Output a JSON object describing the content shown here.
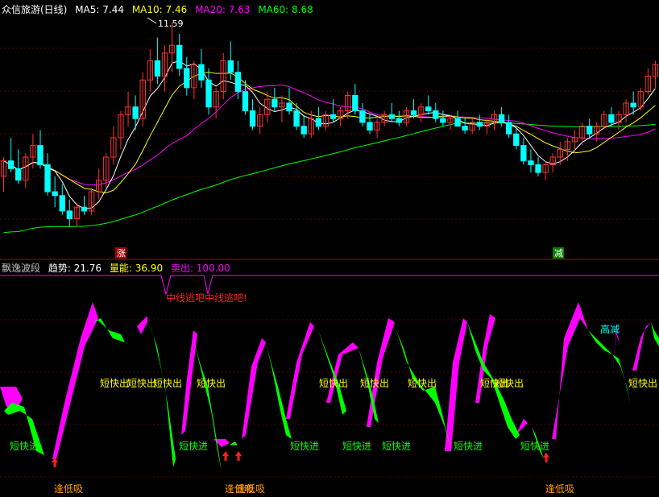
{
  "top_panel": {
    "title": "众信旅游(日线)",
    "ma5_label": "MA5: 7.44",
    "ma10_label": "MA10: 7.46",
    "ma20_label": "MA20: 7.63",
    "ma60_label": "MA60: 8.68",
    "high_marker": "11.59",
    "zhang_label": "涨",
    "jian_label": "减"
  },
  "bottom_panel": {
    "name": "飘逸波段",
    "trend_label": "趋势: 21.76",
    "energy_label": "量能: 36.90",
    "sell_label": "卖出: 100.00",
    "warning_text": "中线逃吧中线逃吧!",
    "gao_jian": "高减",
    "duan_kuai_chu": "短快出",
    "duan_kuai_jin": "短快进",
    "feng_di_xi": "逢低吸"
  },
  "colors": {
    "up": "#ff3232",
    "down": "#00ffff",
    "ma5": "#ffffff",
    "ma10": "#ffff00",
    "ma20": "#ff00ff",
    "ma60": "#00ff00",
    "magenta_band": "#ff00ff",
    "green_band": "#00ff00",
    "label_yellow": "#ffff00",
    "label_green": "#00ff00",
    "label_orange": "#ffa000",
    "warning_red": "#ff2020"
  },
  "chart_data": [
    {
      "type": "candlestick",
      "title": "众信旅游(日线)",
      "high_marker": 11.59,
      "candles": [
        [
          7.6,
          8.1,
          7.2,
          8.0
        ],
        [
          8.0,
          8.6,
          7.7,
          7.8
        ],
        [
          7.8,
          8.3,
          7.4,
          7.5
        ],
        [
          7.5,
          8.2,
          7.3,
          8.1
        ],
        [
          8.1,
          8.7,
          7.8,
          8.4
        ],
        [
          8.4,
          8.8,
          7.8,
          7.9
        ],
        [
          7.9,
          8.2,
          7.1,
          7.2
        ],
        [
          7.2,
          7.6,
          6.8,
          7.1
        ],
        [
          7.1,
          7.4,
          6.6,
          6.7
        ],
        [
          6.7,
          7.0,
          6.3,
          6.5
        ],
        [
          6.5,
          6.9,
          6.3,
          6.8
        ],
        [
          6.8,
          7.1,
          6.6,
          6.7
        ],
        [
          6.7,
          7.3,
          6.6,
          7.2
        ],
        [
          7.2,
          7.8,
          7.0,
          7.5
        ],
        [
          7.5,
          8.2,
          7.3,
          8.1
        ],
        [
          8.1,
          8.9,
          7.9,
          8.6
        ],
        [
          8.6,
          9.3,
          8.3,
          9.2
        ],
        [
          9.2,
          9.8,
          8.9,
          9.4
        ],
        [
          9.4,
          9.7,
          8.8,
          9.1
        ],
        [
          9.1,
          10.3,
          8.9,
          10.1
        ],
        [
          10.1,
          10.9,
          9.8,
          10.6
        ],
        [
          10.6,
          11.2,
          10.0,
          10.2
        ],
        [
          10.2,
          11.0,
          9.8,
          10.8
        ],
        [
          10.8,
          11.59,
          10.3,
          11.0
        ],
        [
          11.0,
          11.3,
          10.2,
          10.4
        ],
        [
          10.4,
          10.7,
          9.7,
          9.9
        ],
        [
          9.9,
          10.6,
          9.6,
          10.5
        ],
        [
          10.5,
          10.9,
          9.9,
          10.1
        ],
        [
          10.1,
          10.4,
          9.2,
          9.4
        ],
        [
          9.4,
          9.9,
          9.1,
          9.8
        ],
        [
          9.8,
          10.8,
          9.6,
          10.6
        ],
        [
          10.6,
          11.1,
          10.1,
          10.3
        ],
        [
          10.3,
          10.6,
          9.6,
          9.8
        ],
        [
          9.8,
          10.1,
          9.2,
          9.3
        ],
        [
          9.3,
          9.6,
          8.8,
          8.9
        ],
        [
          8.9,
          9.4,
          8.7,
          9.2
        ],
        [
          9.2,
          9.8,
          9.0,
          9.6
        ],
        [
          9.6,
          9.9,
          9.3,
          9.4
        ],
        [
          9.4,
          9.7,
          9.0,
          9.5
        ],
        [
          9.5,
          9.9,
          9.2,
          9.3
        ],
        [
          9.3,
          9.5,
          8.8,
          8.9
        ],
        [
          8.9,
          9.2,
          8.6,
          8.7
        ],
        [
          8.7,
          9.3,
          8.6,
          9.1
        ],
        [
          9.1,
          9.4,
          8.8,
          8.9
        ],
        [
          8.9,
          9.3,
          8.8,
          9.2
        ],
        [
          9.2,
          9.6,
          9.0,
          9.1
        ],
        [
          9.1,
          9.4,
          8.9,
          9.3
        ],
        [
          9.3,
          9.8,
          9.1,
          9.7
        ],
        [
          9.7,
          10.0,
          9.2,
          9.3
        ],
        [
          9.3,
          9.5,
          8.9,
          9.0
        ],
        [
          9.0,
          9.2,
          8.7,
          8.8
        ],
        [
          8.8,
          9.1,
          8.6,
          9.0
        ],
        [
          9.0,
          9.3,
          8.9,
          9.2
        ],
        [
          9.2,
          9.5,
          9.0,
          9.1
        ],
        [
          9.1,
          9.3,
          8.9,
          9.0
        ],
        [
          9.0,
          9.4,
          8.9,
          9.3
        ],
        [
          9.3,
          9.6,
          9.1,
          9.2
        ],
        [
          9.2,
          9.5,
          9.0,
          9.4
        ],
        [
          9.4,
          9.7,
          9.2,
          9.3
        ],
        [
          9.3,
          9.5,
          9.0,
          9.1
        ],
        [
          9.1,
          9.3,
          8.9,
          9.0
        ],
        [
          9.0,
          9.2,
          8.8,
          9.1
        ],
        [
          9.1,
          9.3,
          8.9,
          8.9
        ],
        [
          8.9,
          9.1,
          8.7,
          8.8
        ],
        [
          8.8,
          9.1,
          8.7,
          9.0
        ],
        [
          9.0,
          9.2,
          8.8,
          8.9
        ],
        [
          8.9,
          9.1,
          8.7,
          9.0
        ],
        [
          9.0,
          9.3,
          8.8,
          9.2
        ],
        [
          9.2,
          9.4,
          8.9,
          9.0
        ],
        [
          9.0,
          9.2,
          8.6,
          8.7
        ],
        [
          8.7,
          8.9,
          8.3,
          8.4
        ],
        [
          8.4,
          8.6,
          7.9,
          8.0
        ],
        [
          8.0,
          8.3,
          7.7,
          7.9
        ],
        [
          7.9,
          8.1,
          7.6,
          7.7
        ],
        [
          7.7,
          8.0,
          7.5,
          7.9
        ],
        [
          7.9,
          8.2,
          7.7,
          8.1
        ],
        [
          8.1,
          8.5,
          7.9,
          8.3
        ],
        [
          8.3,
          8.6,
          8.0,
          8.5
        ],
        [
          8.5,
          8.8,
          8.2,
          8.6
        ],
        [
          8.6,
          9.0,
          8.4,
          8.9
        ],
        [
          8.9,
          9.1,
          8.6,
          8.7
        ],
        [
          8.7,
          9.0,
          8.5,
          8.9
        ],
        [
          8.9,
          9.3,
          8.8,
          9.2
        ],
        [
          9.2,
          9.4,
          8.9,
          9.0
        ],
        [
          9.0,
          9.3,
          8.8,
          9.2
        ],
        [
          9.2,
          9.6,
          9.0,
          9.5
        ],
        [
          9.5,
          9.8,
          9.2,
          9.4
        ],
        [
          9.4,
          9.9,
          9.3,
          9.8
        ],
        [
          9.8,
          10.4,
          9.7,
          10.2
        ],
        [
          10.2,
          10.6,
          9.9,
          10.5
        ]
      ]
    },
    {
      "type": "area",
      "title": "飘逸波段",
      "series": [
        {
          "name": "趋势",
          "last": 21.76
        },
        {
          "name": "量能",
          "last": 36.9
        },
        {
          "name": "卖出",
          "last": 100.0
        }
      ]
    }
  ]
}
